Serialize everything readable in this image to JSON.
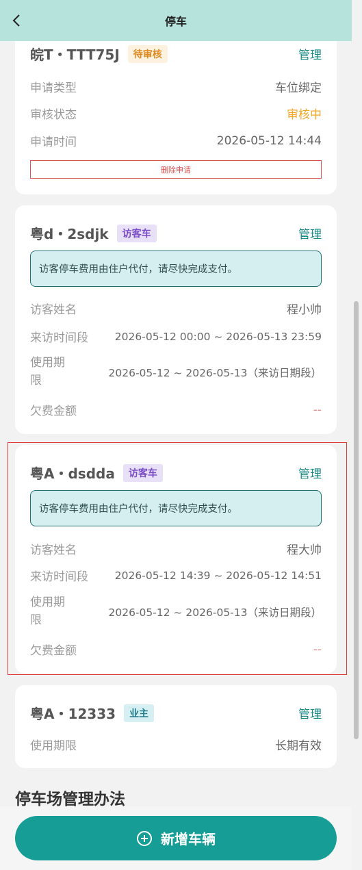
{
  "header": {
    "title": "停车"
  },
  "cards": [
    {
      "plate": "皖T・TTT75J",
      "badge": "待审核",
      "manage": "管理",
      "rows": [
        {
          "label": "申请类型",
          "value": "车位绑定"
        },
        {
          "label": "审核状态",
          "value": "审核中"
        },
        {
          "label": "申请时间",
          "value": "2026-05-12 14:44"
        }
      ],
      "delete_label": "删除申请"
    },
    {
      "plate": "粤d・2sdjk",
      "badge": "访客车",
      "manage": "管理",
      "notice": "访客停车费用由住户代付，请尽快完成支付。",
      "rows": [
        {
          "label": "访客姓名",
          "value": "程小帅"
        },
        {
          "label": "来访时间段",
          "value": "2026-05-12 00:00 ~ 2026-05-13 23:59"
        },
        {
          "label": "使用期限",
          "value": "2026-05-12 ~ 2026-05-13（来访日期段）"
        },
        {
          "label": "欠费金额",
          "value": "--"
        }
      ]
    },
    {
      "plate": "粤A・dsdda",
      "badge": "访客车",
      "manage": "管理",
      "notice": "访客停车费用由住户代付，请尽快完成支付。",
      "rows": [
        {
          "label": "访客姓名",
          "value": "程大帅"
        },
        {
          "label": "来访时间段",
          "value": "2026-05-12 14:39 ~ 2026-05-12 14:51"
        },
        {
          "label": "使用期限",
          "value": "2026-05-12 ~ 2026-05-13（来访日期段）"
        },
        {
          "label": "欠费金额",
          "value": "--"
        }
      ]
    },
    {
      "plate": "粤A・12333",
      "badge": "业主",
      "manage": "管理",
      "rows": [
        {
          "label": "使用期限",
          "value": "长期有效"
        }
      ]
    }
  ],
  "section_title": "停车场管理办法",
  "add_button": "新增车辆",
  "colors": {
    "accent": "#169e96",
    "header_bg": "#b6e3dc",
    "pending": "#f5a623"
  }
}
